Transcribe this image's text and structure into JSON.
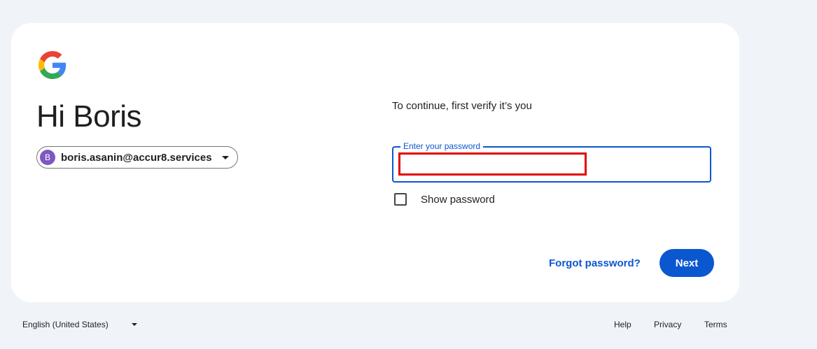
{
  "greeting": "Hi Boris",
  "account": {
    "avatar_initial": "B",
    "email": "boris.asanin@accur8.services",
    "avatar_color": "#7e57c2"
  },
  "verify_text": "To continue, first verify it’s you",
  "password_field": {
    "label": "Enter your password",
    "value": ""
  },
  "show_password": {
    "label": "Show password",
    "checked": false
  },
  "forgot_password_label": "Forgot password?",
  "next_label": "Next",
  "footer": {
    "language": "English (United States)",
    "links": [
      "Help",
      "Privacy",
      "Terms"
    ]
  },
  "colors": {
    "background": "#f0f4f9",
    "card": "#ffffff",
    "accent": "#0b57d0",
    "highlight_box": "#e30000"
  },
  "icons": {
    "logo": "google-g-icon",
    "account_caret": "caret-down-icon",
    "language_caret": "caret-down-icon"
  }
}
